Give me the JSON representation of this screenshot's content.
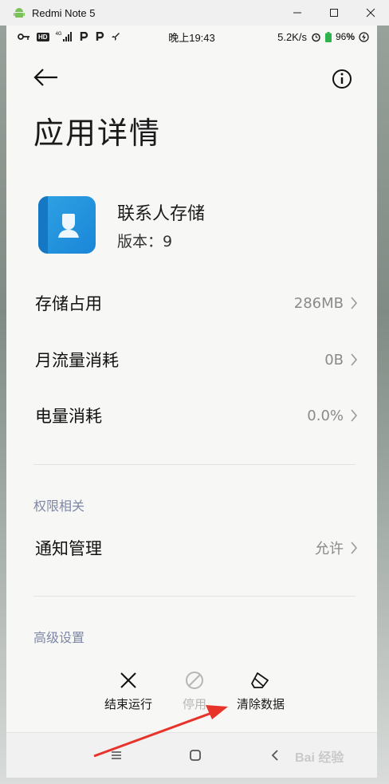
{
  "window": {
    "title": "Redmi Note 5"
  },
  "statusbar": {
    "time": "晚上19:43",
    "net_speed": "5.2K/s",
    "battery": "96",
    "left_icons": [
      "key-icon",
      "hd-icon",
      "signal-4g-icon",
      "p-icon",
      "p-icon",
      "rocket-icon"
    ],
    "right_icons": [
      "alarm-icon",
      "battery-icon",
      "charging-icon"
    ],
    "network_type": "4G",
    "hd_label": "HD",
    "battery_unit": "%"
  },
  "page": {
    "title": "应用详情"
  },
  "app": {
    "name": "联系人存储",
    "version": "版本：9"
  },
  "rows": [
    {
      "label": "存储占用",
      "value": "286MB"
    },
    {
      "label": "月流量消耗",
      "value": "0B"
    },
    {
      "label": "电量消耗",
      "value": "0.0%"
    }
  ],
  "permissions": {
    "section": "权限相关",
    "items": [
      {
        "label": "通知管理",
        "value": "允许"
      }
    ]
  },
  "advanced": {
    "section": "高级设置"
  },
  "actions": {
    "force_stop": "结束运行",
    "disable": "停用",
    "clear_data": "清除数据"
  },
  "watermark": "Bai 经验",
  "colors": {
    "accent_blue": "#1a86d8",
    "section_text": "#7e87a6",
    "annotation_red": "#e8332a"
  }
}
